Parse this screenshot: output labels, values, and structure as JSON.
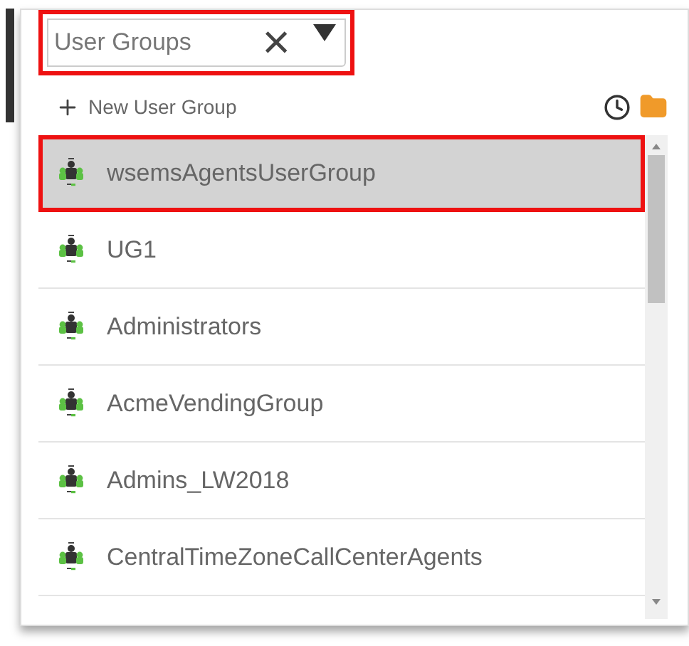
{
  "dropdown": {
    "value": "User Groups",
    "highlighted": true,
    "clear_glyph": "×"
  },
  "new_button": {
    "label": "New User Group"
  },
  "list": {
    "items": [
      {
        "name": "wsemsAgentsUserGroup",
        "selected": true
      },
      {
        "name": "UG1",
        "selected": false
      },
      {
        "name": "Administrators",
        "selected": false
      },
      {
        "name": "AcmeVendingGroup",
        "selected": false
      },
      {
        "name": "Admins_LW2018",
        "selected": false
      },
      {
        "name": "CentralTimeZoneCallCenterAgents",
        "selected": false
      }
    ]
  }
}
